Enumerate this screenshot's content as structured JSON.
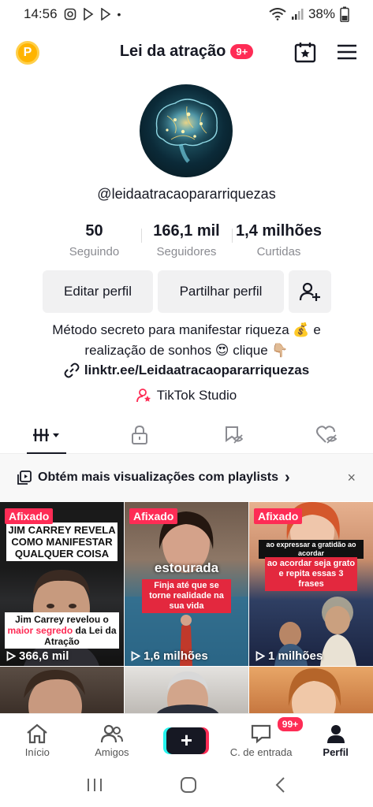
{
  "status_bar": {
    "time": "14:56",
    "battery": "38%"
  },
  "header": {
    "title": "Lei da atração",
    "notif_badge": "9+"
  },
  "profile": {
    "username": "@leidaatracaopararriquezas",
    "stats": [
      {
        "value": "50",
        "label": "Seguindo"
      },
      {
        "value": "166,1 mil",
        "label": "Seguidores"
      },
      {
        "value": "1,4 milhões",
        "label": "Curtidas"
      }
    ],
    "edit_button": "Editar perfil",
    "share_button": "Partilhar perfil",
    "bio_line1": "Método secreto para manifestar riqueza 💰 e",
    "bio_line2": "realização de sonhos 😍 clique 👇🏼",
    "link": "linktr.ee/Leidaatracaopararriquezas",
    "studio": "TikTok Studio"
  },
  "banner": {
    "text": "Obtém mais visualizações com playlists",
    "arrow": "›",
    "close": "×"
  },
  "videos": [
    {
      "pinned": "Afixado",
      "views": "366,6 mil",
      "top_text": "JIM CARREY REVELA COMO MANIFESTAR QUALQUER COISA",
      "caption_line1": "Jim Carrey revelou o",
      "caption_highlight": "maior segredo",
      "caption_line2": "da Lei da Atração"
    },
    {
      "pinned": "Afixado",
      "views": "1,6 milhões",
      "top_text": "estourada",
      "caption": "Finja até que se torne realidade na sua vida"
    },
    {
      "pinned": "Afixado",
      "views": "1 milhões",
      "top_text": "ao expressar a gratidão ao acordar",
      "caption": "ao acordar seja grato e repita essas 3 frases"
    }
  ],
  "bottom_nav": {
    "items": [
      {
        "label": "Início"
      },
      {
        "label": "Amigos"
      },
      {
        "label": "+"
      },
      {
        "label": "C. de entrada",
        "badge": "99+"
      },
      {
        "label": "Perfil"
      }
    ]
  },
  "colors": {
    "accent": "#fe2c55",
    "cyan": "#25f4ee",
    "coin": "#ffb400"
  }
}
